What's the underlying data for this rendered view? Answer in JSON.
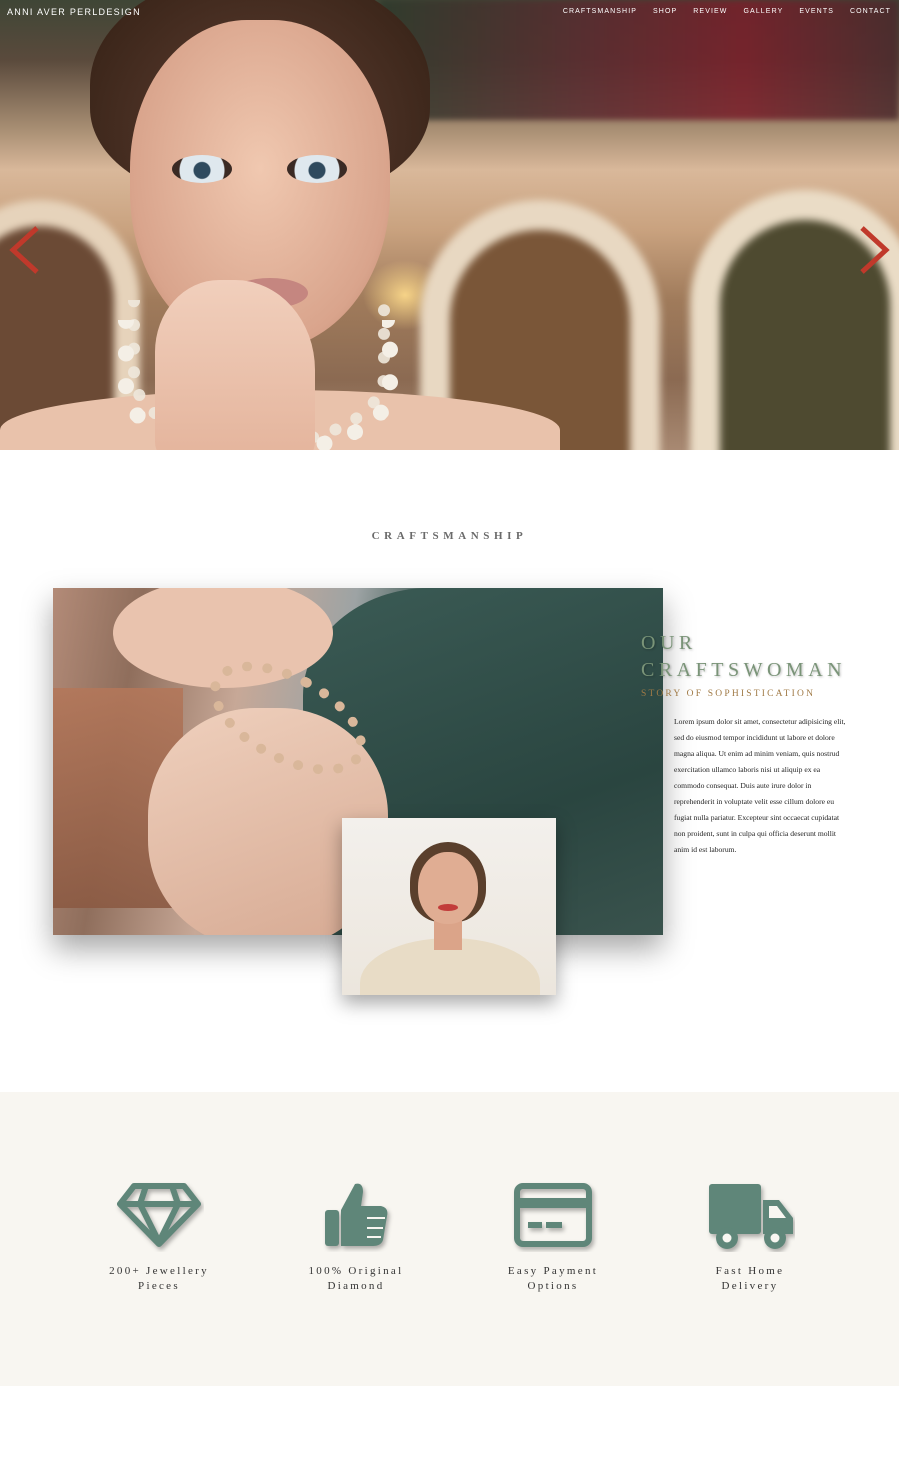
{
  "header": {
    "brand": "ANNI AVER PERLDESIGN",
    "nav": [
      "CRAFTSMANSHIP",
      "SHOP",
      "REVIEW",
      "GALLERY",
      "EVENTS",
      "CONTACT"
    ]
  },
  "hero": {
    "prev_icon": "chevron-left-icon",
    "next_icon": "chevron-right-icon",
    "arrow_color": "#c0392b"
  },
  "craftsmanship": {
    "section_title": "CRAFTSMANSHIP",
    "heading_line1": "OUR",
    "heading_line2": "CRAFTSWOMAN",
    "subheading": "STORY OF SOPHISTICATION",
    "body": "Lorem ipsum dolor sit amet, consectetur adipisicing elit, sed do eiusmod tempor incididunt ut labore et dolore magna aliqua. Ut enim ad minim veniam, quis nostrud exercitation ullamco laboris nisi ut aliquip ex ea commodo consequat. Duis aute irure dolor in reprehenderit in voluptate velit esse cillum dolore eu fugiat nulla pariatur. Excepteur sint occaecat cupidatat non proident, sunt in culpa qui officia deserunt mollit anim id est laborum.",
    "heading_color": "#7a9478",
    "subheading_color": "#a07a46"
  },
  "features": {
    "icon_color": "#5f8679",
    "items": [
      {
        "icon": "diamond-icon",
        "label": "200+ Jewellery\nPieces"
      },
      {
        "icon": "thumbs-up-icon",
        "label": "100% Original\nDiamond"
      },
      {
        "icon": "credit-card-icon",
        "label": "Easy Payment\nOptions"
      },
      {
        "icon": "truck-icon",
        "label": "Fast Home\nDelivery"
      }
    ]
  }
}
